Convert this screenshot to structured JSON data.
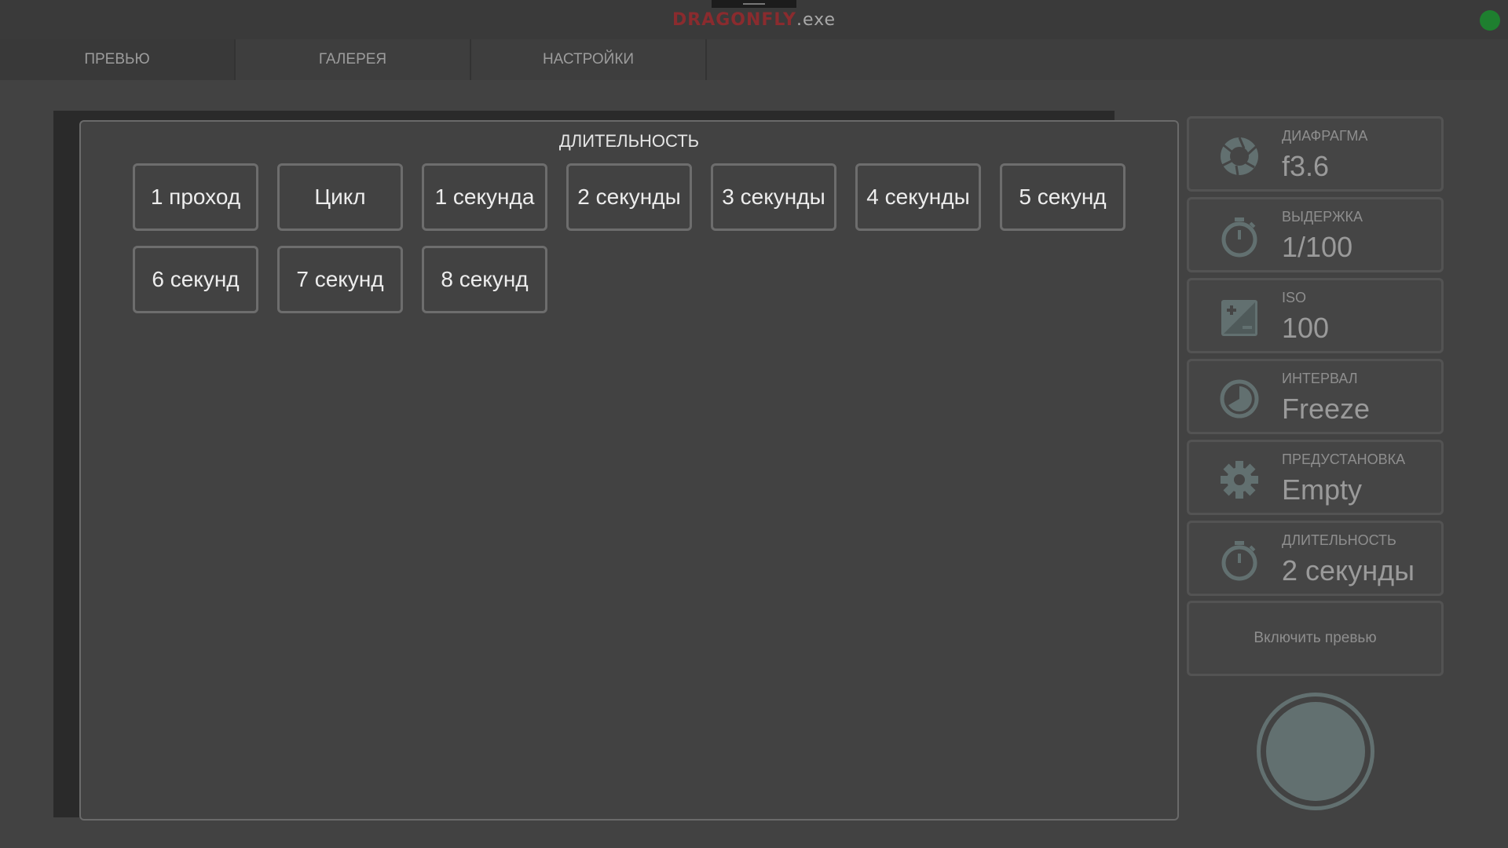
{
  "window": {
    "brand": "DRAGONFLY",
    "ext": ".exe"
  },
  "colors": {
    "accent_brand": "#8a2b2e",
    "status_dot": "#1e7f2f",
    "icon_color": "#627070"
  },
  "tabs": [
    {
      "label": "ПРЕВЬЮ",
      "active": true
    },
    {
      "label": "ГАЛЕРЕЯ",
      "active": false
    },
    {
      "label": "НАСТРОЙКИ",
      "active": false
    }
  ],
  "duration_panel": {
    "title": "ДЛИТЕЛЬНОСТЬ",
    "options": [
      "1 проход",
      "Цикл",
      "1 секунда",
      "2 секунды",
      "3 секунды",
      "4 секунды",
      "5 секунд",
      "6 секунд",
      "7 секунд",
      "8 секунд"
    ]
  },
  "settings": [
    {
      "label": "ДИАФРАГМА",
      "value": "f3.6",
      "icon": "aperture-icon"
    },
    {
      "label": "ВЫДЕРЖКА",
      "value": "1/100",
      "icon": "stopwatch-icon"
    },
    {
      "label": "ISO",
      "value": "100",
      "icon": "exposure-icon"
    },
    {
      "label": "ИНТЕРВАЛ",
      "value": "Freeze",
      "icon": "clock-icon"
    },
    {
      "label": "ПРЕДУСТАНОВКА",
      "value": "Empty",
      "icon": "gear-icon"
    },
    {
      "label": "ДЛИТЕЛЬНОСТЬ",
      "value": "2 секунды",
      "icon": "stopwatch-icon"
    }
  ],
  "preview_toggle": {
    "label": "Включить превью"
  }
}
